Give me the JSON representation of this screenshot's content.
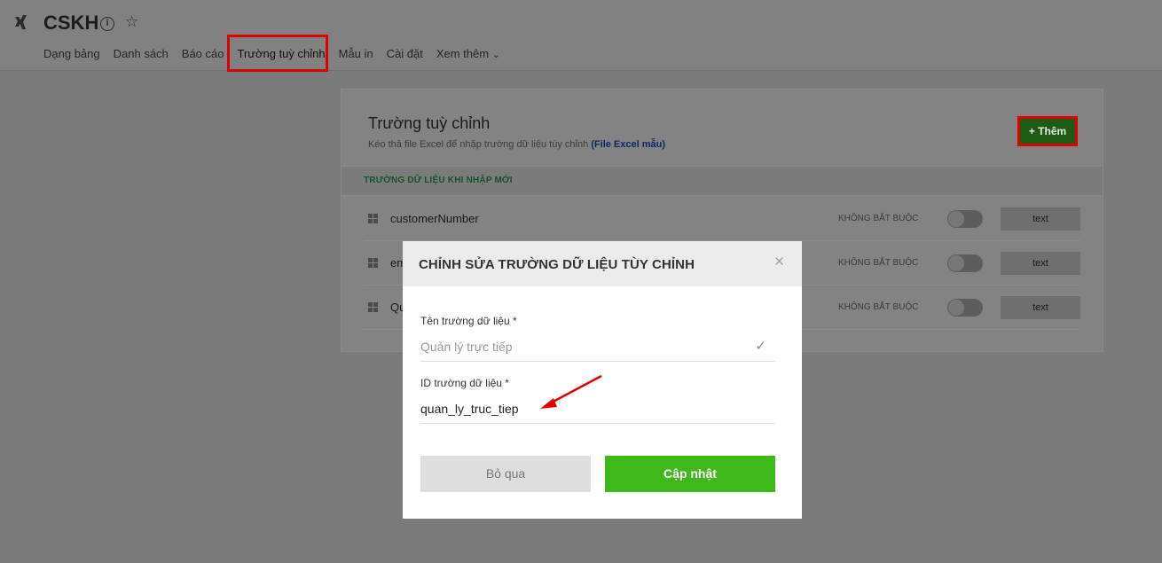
{
  "header": {
    "title": "CSKH",
    "nav": [
      "Dạng bảng",
      "Danh sách",
      "Báo cáo",
      "Trường tuỳ chỉnh",
      "Mẫu in",
      "Cài đặt",
      "Xem thêm"
    ],
    "more_chevron": "⌄"
  },
  "card": {
    "title": "Trường tuỳ chỉnh",
    "subtitle": "Kéo thả file Excel để nhập trường dữ liệu tùy chỉnh",
    "subtitle_link": "(File Excel mẫu)",
    "add_button": "+ Thêm",
    "section_label": "TRƯỜNG DỮ LIỆU KHI NHẬP MỚI",
    "rows": [
      {
        "name": "customerNumber",
        "required": "KHÔNG BẮT BUỘC",
        "type": "text"
      },
      {
        "name": "em",
        "required": "KHÔNG BẮT BUỘC",
        "type": "text"
      },
      {
        "name": "Qu",
        "required": "KHÔNG BẮT BUỘC",
        "type": "text"
      }
    ]
  },
  "modal": {
    "title": "CHỈNH SỬA TRƯỜNG DỮ LIỆU TÙY CHỈNH",
    "close": "×",
    "name_label": "Tên trường dữ liệu *",
    "name_value": "Quản lý trực tiếp",
    "id_label": "ID trường dữ liệu *",
    "id_value": "quan_ly_truc_tiep",
    "cancel": "Bỏ qua",
    "update": "Cập nhật"
  },
  "colors": {
    "accent_green": "#3fb81b",
    "highlight_red": "#e00000"
  }
}
